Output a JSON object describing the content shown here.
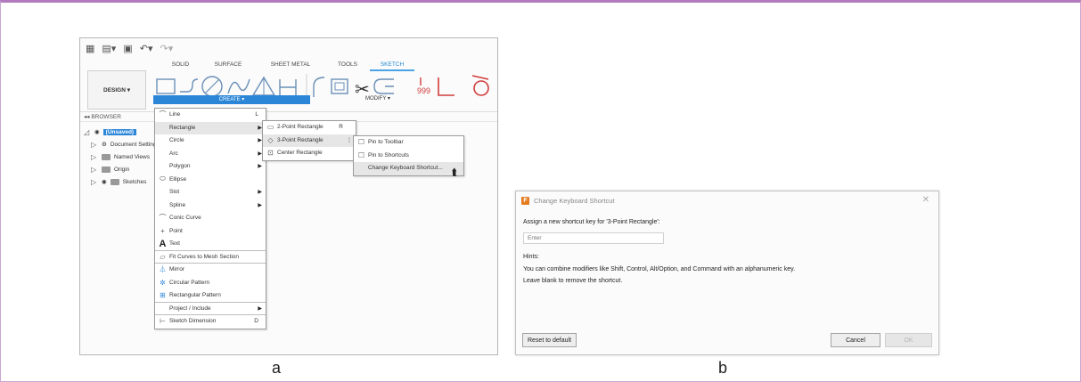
{
  "panel_a": {
    "tabs": [
      "SOLID",
      "SURFACE",
      "SHEET METAL",
      "TOOLS",
      "SKETCH"
    ],
    "design_button": "DESIGN ▾",
    "create_label": "CREATE ▾",
    "modify_label": "MODIFY ▾",
    "browser_label": "BROWSER",
    "tree": [
      "(Unsaved)",
      "Document Settings",
      "Named Views",
      "Origin",
      "Sketches"
    ],
    "create_menu": [
      {
        "label": "Line",
        "key": "L",
        "icon": "line-icon"
      },
      {
        "label": "Rectangle",
        "submenu": true,
        "selected": true
      },
      {
        "label": "Circle",
        "submenu": true
      },
      {
        "label": "Arc",
        "submenu": true
      },
      {
        "label": "Polygon",
        "submenu": true
      },
      {
        "label": "Ellipse",
        "icon": "ellipse-icon"
      },
      {
        "label": "Slot",
        "submenu": true
      },
      {
        "label": "Spline",
        "submenu": true
      },
      {
        "label": "Conic Curve",
        "icon": "conic-curve-icon"
      },
      {
        "label": "Point",
        "icon": "point-icon"
      },
      {
        "label": "Text",
        "icon": "text-icon"
      },
      {
        "label": "Fit Curves to Mesh Section",
        "icon": "fit-curves-icon"
      },
      {
        "label": "Mirror",
        "icon": "mirror-icon"
      },
      {
        "label": "Circular Pattern",
        "icon": "circular-pattern-icon"
      },
      {
        "label": "Rectangular Pattern",
        "icon": "rectangular-pattern-icon"
      },
      {
        "label": "Project / Include",
        "submenu": true
      },
      {
        "label": "Sketch Dimension",
        "key": "D",
        "icon": "sketch-dimension-icon"
      }
    ],
    "rect_menu": [
      {
        "label": "2-Point Rectangle",
        "key": "R"
      },
      {
        "label": "3-Point Rectangle",
        "selected": true
      },
      {
        "label": "Center Rectangle"
      }
    ],
    "pin_menu": [
      {
        "label": "Pin to Toolbar"
      },
      {
        "label": "Pin to Shortcuts"
      },
      {
        "label": "Change Keyboard Shortcut...",
        "selected": true
      }
    ],
    "caption": "a"
  },
  "panel_b": {
    "title": "Change Keyboard Shortcut",
    "close": "✕",
    "prompt": "Assign a new shortcut key for '3-Point Rectangle':",
    "input_placeholder": "Enter",
    "hints_heading": "Hints:",
    "hint_1": "You can combine modifiers like Shift, Control, Alt/Option, and Command with an alphanumeric key.",
    "hint_2": "Leave blank to remove the shortcut.",
    "reset_label": "Reset to default",
    "cancel_label": "Cancel",
    "ok_label": "OK",
    "caption": "b"
  },
  "colors": {
    "accent": "#2c86d8",
    "frame": "#b37bbf",
    "logo": "#e57a1e"
  }
}
